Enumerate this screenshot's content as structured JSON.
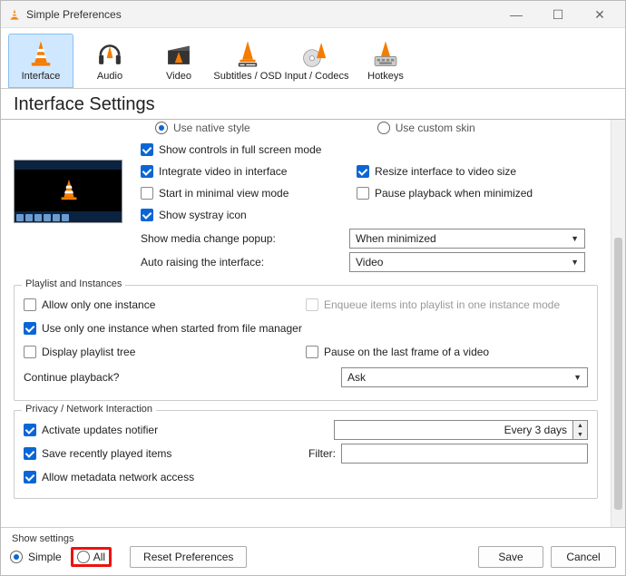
{
  "window": {
    "title": "Simple Preferences"
  },
  "tabs": [
    {
      "label": "Interface"
    },
    {
      "label": "Audio"
    },
    {
      "label": "Video"
    },
    {
      "label": "Subtitles / OSD"
    },
    {
      "label": "Input / Codecs"
    },
    {
      "label": "Hotkeys"
    }
  ],
  "page_heading": "Interface Settings",
  "style_radio": {
    "native": "Use native style",
    "custom": "Use custom skin"
  },
  "top_opts": {
    "fullscreen_controls": "Show controls in full screen mode",
    "integrate_video": "Integrate video in interface",
    "resize_to_video": "Resize interface to video size",
    "minimal_view": "Start in minimal view mode",
    "pause_minimized": "Pause playback when minimized",
    "systray": "Show systray icon",
    "media_popup_label": "Show media change popup:",
    "media_popup_value": "When minimized",
    "auto_raise_label": "Auto raising the interface:",
    "auto_raise_value": "Video"
  },
  "playlist_group": {
    "title": "Playlist and Instances",
    "one_instance": "Allow only one instance",
    "enqueue": "Enqueue items into playlist in one instance mode",
    "one_from_fm": "Use only one instance when started from file manager",
    "playlist_tree": "Display playlist tree",
    "pause_last_frame": "Pause on the last frame of a video",
    "continue_label": "Continue playback?",
    "continue_value": "Ask"
  },
  "privacy_group": {
    "title": "Privacy / Network Interaction",
    "updates": "Activate updates notifier",
    "updates_value": "Every 3 days",
    "recent": "Save recently played items",
    "filter_label": "Filter:",
    "metadata": "Allow metadata network access"
  },
  "bottom": {
    "show_settings": "Show settings",
    "simple": "Simple",
    "all": "All",
    "reset": "Reset Preferences",
    "save": "Save",
    "cancel": "Cancel"
  }
}
